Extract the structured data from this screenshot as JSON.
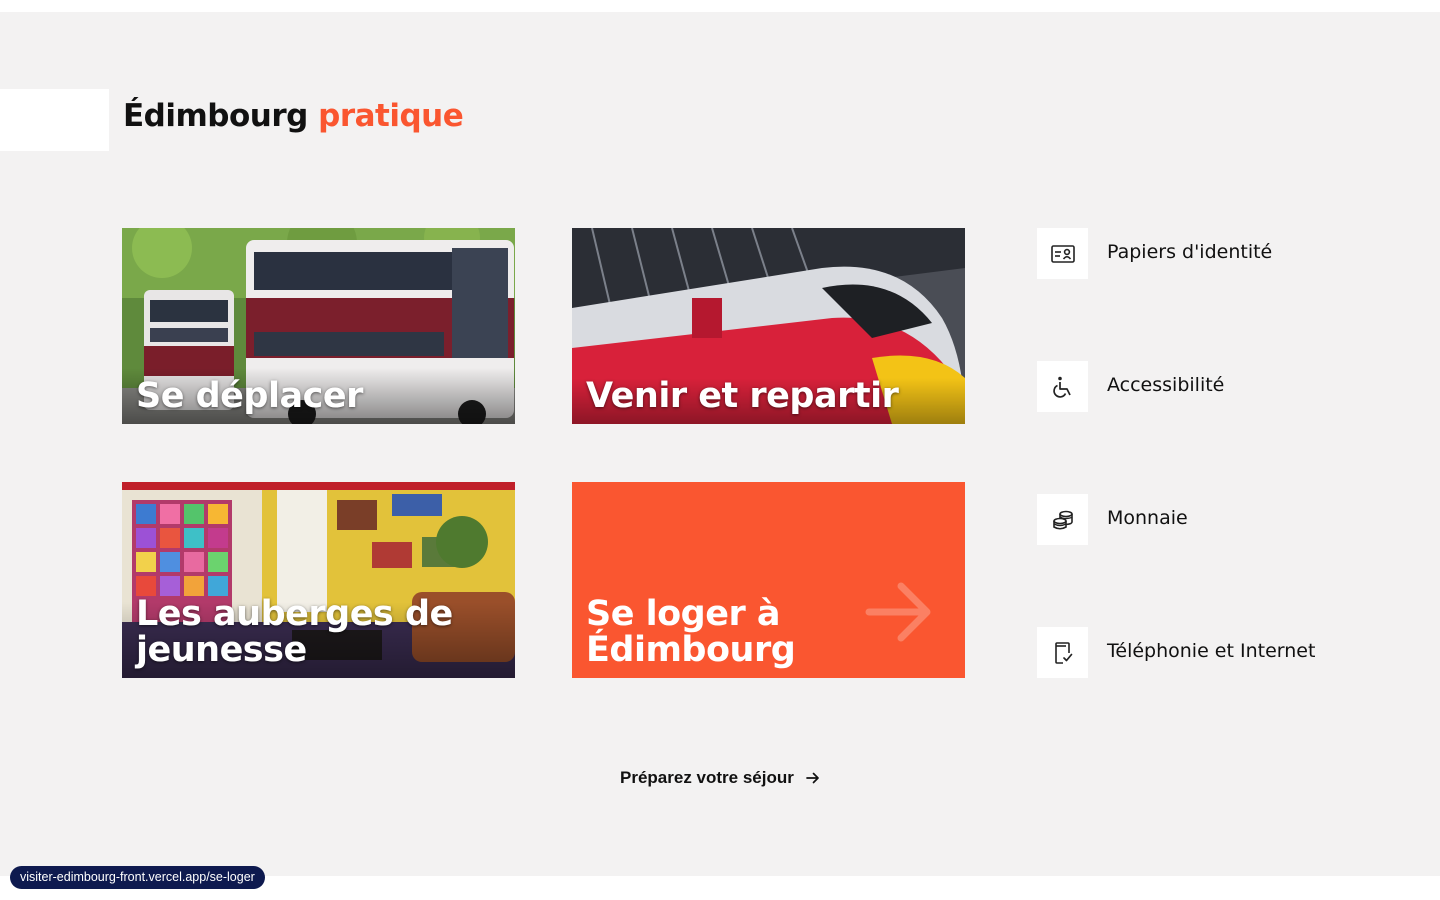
{
  "section": {
    "title_main": "Édimbourg",
    "title_accent": "pratique"
  },
  "cards": [
    {
      "label": "Se déplacer",
      "image": "double-decker-buses-photo"
    },
    {
      "label": "Venir et repartir",
      "image": "lner-azuma-train-photo"
    },
    {
      "label": "Les auberges de jeunesse",
      "image": "hostel-lounge-photo"
    },
    {
      "label": "Se loger à Édimbourg",
      "icon": "arrow-right-icon"
    }
  ],
  "side_links": [
    {
      "label": "Papiers d'identité",
      "icon": "id-card-icon"
    },
    {
      "label": "Accessibilité",
      "icon": "wheelchair-icon"
    },
    {
      "label": "Monnaie",
      "icon": "coins-icon"
    },
    {
      "label": "Téléphonie et Internet",
      "icon": "phone-icon"
    }
  ],
  "cta": {
    "label": "Préparez votre séjour",
    "icon": "arrow-right-icon"
  },
  "status_bar": {
    "url": "visiter-edimbourg-front.vercel.app/se-loger"
  },
  "colors": {
    "accent": "#fa5630",
    "background": "#f3f2f2",
    "status_bg": "#0e1a4f"
  }
}
